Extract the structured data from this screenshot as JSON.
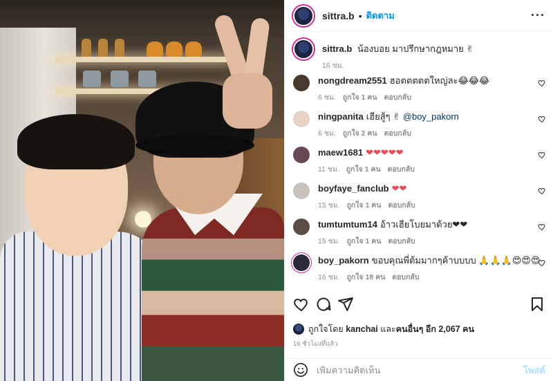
{
  "post": {
    "username": "sittra.b",
    "follow_label": "ติดตาม",
    "more_label": "···"
  },
  "caption": {
    "username": "sittra.b",
    "text": "น้องบอย มาปรึกษากฎหมาย ✌",
    "time": "16 ชม."
  },
  "comments": [
    {
      "username": "nongdream2551",
      "text": "ฮอตตตตตใหญ่ละ😂😂😂",
      "mention": "",
      "time": "6 ชม.",
      "likes": "ถูกใจ 1 คน",
      "reply": "ตอบกลับ",
      "avatar_color": "#4a3a2e"
    },
    {
      "username": "ningpanita",
      "text": "เฮียสู้ๆ ✌",
      "mention": "@boy_pakorn",
      "time": "6 ชม.",
      "likes": "ถูกใจ 2 คน",
      "reply": "ตอบกลับ",
      "avatar_color": "#e8d2c4"
    },
    {
      "username": "maew1681",
      "text": "❤❤❤❤❤",
      "mention": "",
      "time": "11 ชม.",
      "likes": "ถูกใจ 1 คน",
      "reply": "ตอบกลับ",
      "avatar_color": "#6a4a52"
    },
    {
      "username": "boyfaye_fanclub",
      "text": "❤❤",
      "mention": "",
      "time": "15 ชม.",
      "likes": "ถูกใจ 1 คน",
      "reply": "ตอบกลับ",
      "avatar_color": "#c9c1bb"
    },
    {
      "username": "tumtumtum14",
      "text": "อ้าวเฮียโบยมาด้วย❤❤",
      "mention": "",
      "time": "15 ชม.",
      "likes": "ถูกใจ 1 คน",
      "reply": "ตอบกลับ",
      "avatar_color": "#5b4f45"
    },
    {
      "username": "boy_pakorn",
      "text": "ขอบคุณพี่ต้มมากๆค้าบบบบ 🙏🙏🙏😍😍😍",
      "mention": "",
      "time": "16 ชม.",
      "likes": "ถูกใจ 18 คน",
      "reply": "ตอบกลับ",
      "avatar_color": "#2c2a3a"
    }
  ],
  "likes": {
    "prefix": "ถูกใจโดย",
    "user": "kanchai",
    "middle": "และ",
    "others": "คนอื่นๆ อีก 2,067 คน"
  },
  "time_ago": "16 ชั่วโมงที่แล้ว",
  "add_comment": {
    "placeholder": "เพิ่มความคิดเห็น",
    "post_label": "โพสต์"
  },
  "colors": {
    "link_blue": "#0095f6",
    "story_ring": "#d6249f",
    "heart_red": "#ed4956",
    "muted": "#8e8e8e"
  },
  "icons": [
    "heart-icon",
    "comment-icon",
    "share-icon",
    "bookmark-icon",
    "emoji-icon",
    "more-icon"
  ]
}
